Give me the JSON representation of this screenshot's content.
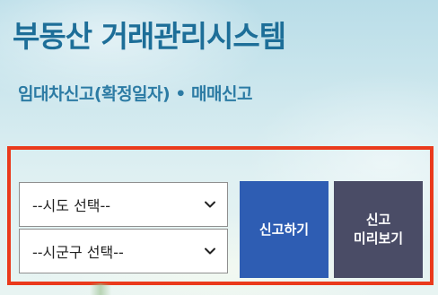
{
  "header": {
    "title": "부동산 거래관리시스템",
    "subtitle": "임대차신고(확정일자) • 매매신고"
  },
  "form": {
    "sido_select": {
      "value": "--시도 선택--"
    },
    "sigungu_select": {
      "value": "--시군구 선택--"
    },
    "report_button": "신고하기",
    "preview_button": {
      "line1": "신고",
      "line2": "미리보기"
    }
  },
  "colors": {
    "title": "#1d6e98",
    "panel_border": "#ea3a1c",
    "report_button_bg": "#2e5db3",
    "preview_button_bg": "#4a4c66"
  },
  "icons": [
    "chevron-down-icon"
  ]
}
